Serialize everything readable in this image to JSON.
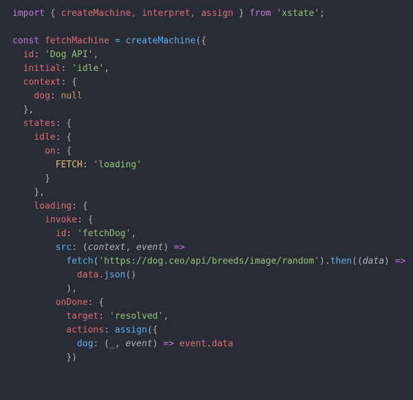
{
  "code": {
    "import_kw": "import",
    "import_names": "createMachine, interpret, assign",
    "from_kw": "from",
    "xstate_str": "'xstate'",
    "const_kw": "const",
    "fetchMachine": "fetchMachine",
    "createMachine": "createMachine",
    "id_key": "id",
    "id_val": "'Dog API'",
    "initial_key": "initial",
    "initial_val": "'idle'",
    "context_key": "context",
    "dog_key": "dog",
    "null_val": "null",
    "states_key": "states",
    "idle_key": "idle",
    "on_key": "on",
    "fetch_event": "FETCH",
    "loading_str": "'loading'",
    "loading_key": "loading",
    "invoke_key": "invoke",
    "invoke_id_key": "id",
    "invoke_id_val": "'fetchDog'",
    "src_key": "src",
    "ctx_param": "context",
    "event_param": "event",
    "fetch_fn": "fetch",
    "fetch_url": "'https://dog.ceo/api/breeds/image/random'",
    "then_fn": "then",
    "data_param": "data",
    "data_id": "data",
    "json_fn": "json",
    "onDone_key": "onDone",
    "target_key": "target",
    "resolved_str": "'resolved'",
    "actions_key": "actions",
    "assign_fn": "assign",
    "dog_prop": "dog",
    "underscore": "_",
    "event_param2": "event",
    "event_id": "event",
    "data_prop": "data"
  }
}
